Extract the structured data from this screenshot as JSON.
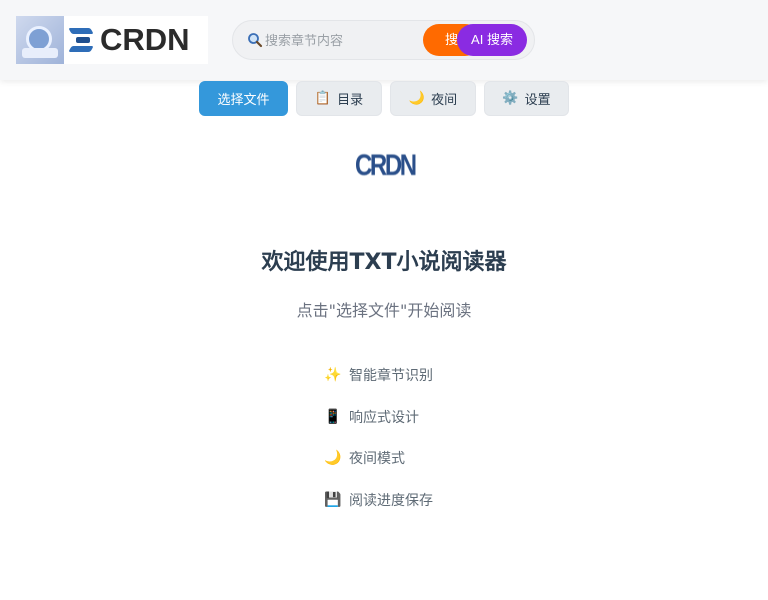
{
  "header": {
    "logo_text": "CRDN",
    "search": {
      "placeholder": "搜索章节内容",
      "search_label": "搜索",
      "ai_search_label": "AI 搜索"
    }
  },
  "toolbar": {
    "select_file_label": "选择文件",
    "toc_label": "目录",
    "night_label": "夜间",
    "settings_label": "设置",
    "toc_icon": "📋",
    "night_icon": "🌙",
    "settings_icon": "⚙️"
  },
  "welcome": {
    "small_logo_text": "CRDN",
    "title": "欢迎使用TXT小说阅读器",
    "subtitle": "点击\"选择文件\"开始阅读",
    "features": [
      {
        "icon": "✨",
        "label": "智能章节识别"
      },
      {
        "icon": "📱",
        "label": "响应式设计"
      },
      {
        "icon": "🌙",
        "label": "夜间模式"
      },
      {
        "icon": "💾",
        "label": "阅读进度保存"
      }
    ]
  },
  "colors": {
    "primary": "#3498db",
    "search_button": "#ff6a00",
    "ai_button": "#8a2be2"
  }
}
